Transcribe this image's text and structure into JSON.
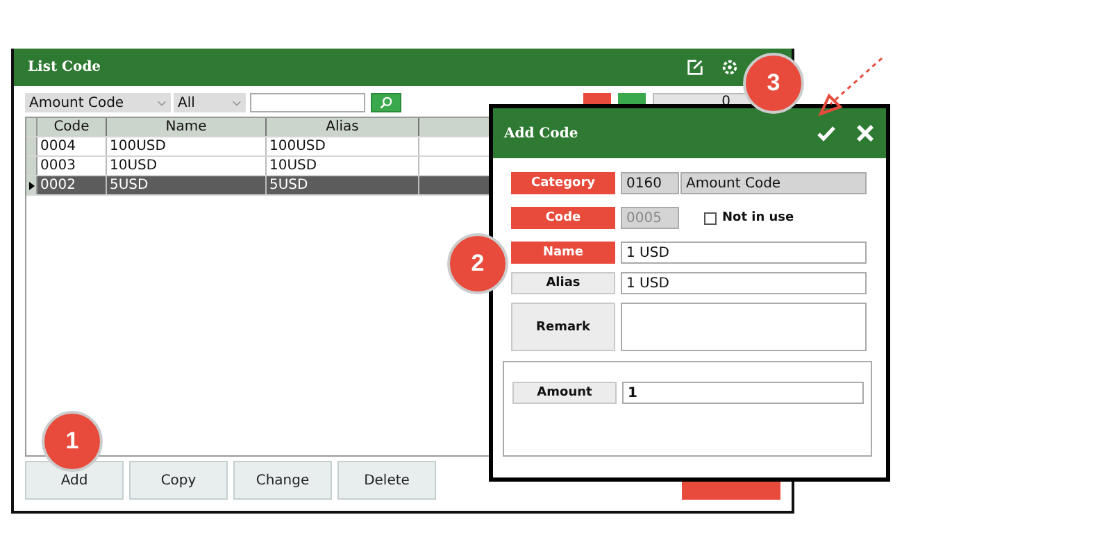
{
  "window": {
    "title": "List Code"
  },
  "filters": {
    "category": "Amount Code",
    "status": "All"
  },
  "toolbar_field": {
    "value": "0"
  },
  "grid": {
    "columns": [
      "Code",
      "Name",
      "Alias"
    ],
    "rows": [
      {
        "cells": [
          "0004",
          "100USD",
          "100USD"
        ],
        "selected": false
      },
      {
        "cells": [
          "0003",
          "10USD",
          "10USD"
        ],
        "selected": false
      },
      {
        "cells": [
          "0002",
          "5USD",
          "5USD"
        ],
        "selected": true
      }
    ]
  },
  "buttons": [
    {
      "label": "Add",
      "kind": "plain"
    },
    {
      "label": "Copy",
      "kind": "plain"
    },
    {
      "label": "Change",
      "kind": "plain"
    },
    {
      "label": "Delete",
      "kind": "plain"
    },
    {
      "kind": "danger"
    }
  ],
  "dialog": {
    "title": "Add Code",
    "fields": [
      {
        "label": "Category",
        "required": true,
        "kind": "pair",
        "code": "0160",
        "value": "Amount Code"
      },
      {
        "label": "Code",
        "required": true,
        "kind": "code",
        "value": "0005",
        "disabled": true,
        "checkbox": {
          "label": "Not in use",
          "checked": false
        }
      },
      {
        "label": "Name",
        "required": true,
        "kind": "text",
        "value": "1 USD"
      },
      {
        "label": "Alias",
        "required": false,
        "kind": "text",
        "value": "1 USD"
      },
      {
        "label": "Remark",
        "required": false,
        "kind": "memo"
      }
    ],
    "group": [
      {
        "label": "Amount",
        "value": "1"
      }
    ]
  },
  "markers": [
    {
      "label": "1"
    },
    {
      "label": "2"
    },
    {
      "label": "3"
    }
  ]
}
